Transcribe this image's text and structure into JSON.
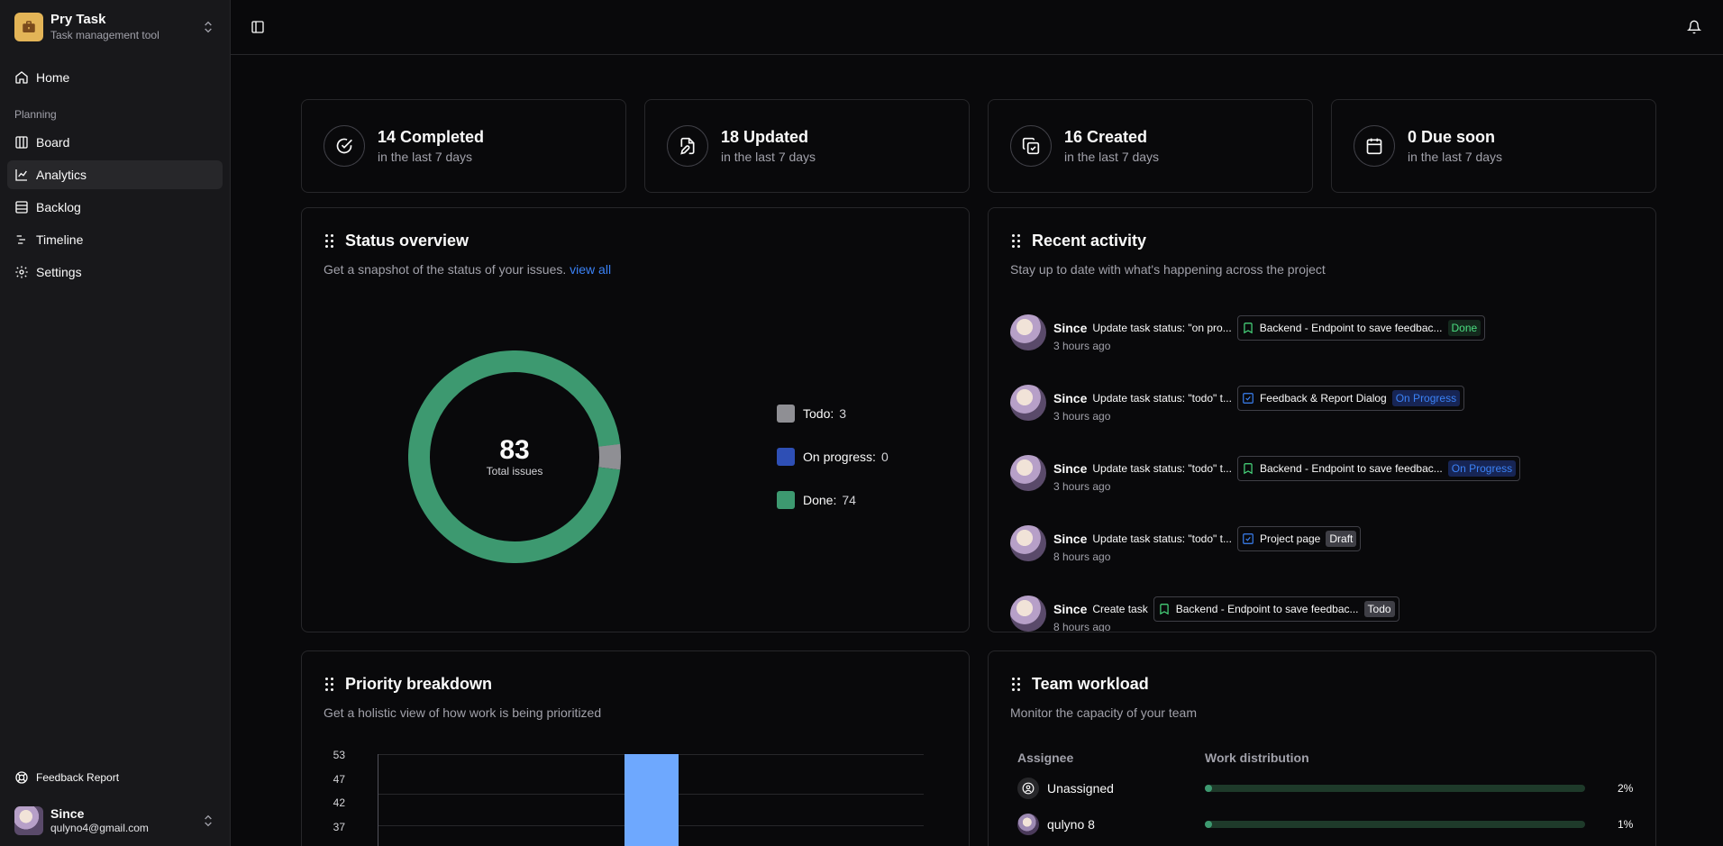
{
  "brand": {
    "name": "Pry Task",
    "subtitle": "Task management tool"
  },
  "nav": {
    "home": "Home",
    "group": "Planning",
    "items": [
      "Board",
      "Analytics",
      "Backlog",
      "Timeline",
      "Settings"
    ],
    "active": "Analytics"
  },
  "sidebar_bottom": {
    "feedback": "Feedback Report",
    "user_name": "Since",
    "user_email": "qulyno4@gmail.com"
  },
  "stats": [
    {
      "title": "14 Completed",
      "sub": "in the last 7 days",
      "icon": "check-circle-icon"
    },
    {
      "title": "18 Updated",
      "sub": "in the last 7 days",
      "icon": "file-edit-icon"
    },
    {
      "title": "16 Created",
      "sub": "in the last 7 days",
      "icon": "copy-check-icon"
    },
    {
      "title": "0 Due soon",
      "sub": "in the last 7 days",
      "icon": "calendar-icon"
    }
  ],
  "status": {
    "title": "Status overview",
    "desc": "Get a snapshot of the status of your issues.",
    "link": "view all",
    "total": "83",
    "total_label": "Total issues",
    "legend": [
      {
        "label": "Todo:",
        "value": "3",
        "color": "#8f8f94"
      },
      {
        "label": "On progress:",
        "value": "0",
        "color": "#2e4fb5"
      },
      {
        "label": "Done:",
        "value": "74",
        "color": "#3d9970"
      }
    ]
  },
  "activity": {
    "title": "Recent activity",
    "desc": "Stay up to date with what's happening across the project",
    "items": [
      {
        "user": "Since",
        "text": "Update task status: \"on pro...",
        "task": "Backend - Endpoint to save feedbac...",
        "status": "Done",
        "time": "3 hours ago",
        "kind": "bookmark"
      },
      {
        "user": "Since",
        "text": "Update task status: \"todo\" t...",
        "task": "Feedback & Report Dialog",
        "status": "On Progress",
        "time": "3 hours ago",
        "kind": "check"
      },
      {
        "user": "Since",
        "text": "Update task status: \"todo\" t...",
        "task": "Backend - Endpoint to save feedbac...",
        "status": "On Progress",
        "time": "3 hours ago",
        "kind": "bookmark"
      },
      {
        "user": "Since",
        "text": "Update task status: \"todo\" t...",
        "task": "Project page",
        "status": "Draft",
        "time": "8 hours ago",
        "kind": "check"
      },
      {
        "user": "Since",
        "text": "Create task",
        "task": "Backend - Endpoint to save feedbac...",
        "status": "Todo",
        "time": "8 hours ago",
        "kind": "bookmark"
      }
    ]
  },
  "priority": {
    "title": "Priority breakdown",
    "desc": "Get a holistic view of how work is being prioritized"
  },
  "chart_data": {
    "type": "bar",
    "yticks": [
      "53",
      "47",
      "42",
      "37"
    ],
    "visible_bar": {
      "top_value": 53
    }
  },
  "workload": {
    "title": "Team workload",
    "desc": "Monitor the capacity of your team",
    "col_assignee": "Assignee",
    "col_dist": "Work distribution",
    "rows": [
      {
        "name": "Unassigned",
        "pct": "2%",
        "fraction": 0.02
      },
      {
        "name": "qulyno 8",
        "pct": "1%",
        "fraction": 0.01
      }
    ]
  }
}
